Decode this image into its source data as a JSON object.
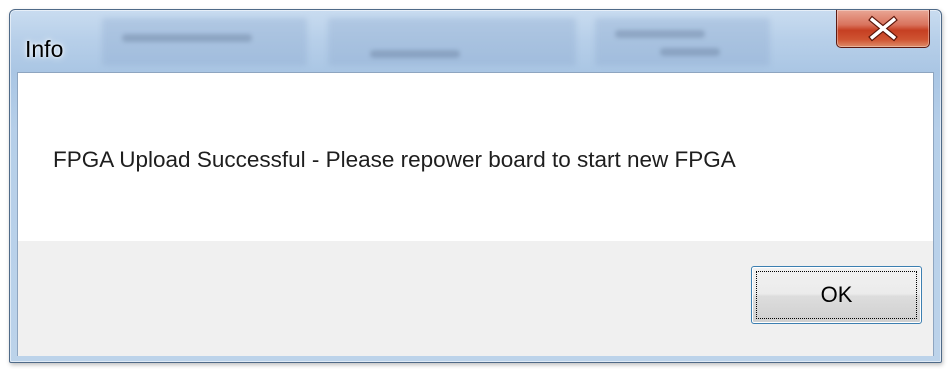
{
  "window": {
    "title": "Info",
    "close_icon": "close-x-icon"
  },
  "dialog": {
    "message": "FPGA Upload Successful - Please repower board to start new FPGA",
    "ok_label": "OK"
  },
  "colors": {
    "close_button": "#c63f22",
    "title_bar": "#b7cfe9",
    "footer": "#f0f0f0",
    "ok_border": "#3c7fb1"
  }
}
